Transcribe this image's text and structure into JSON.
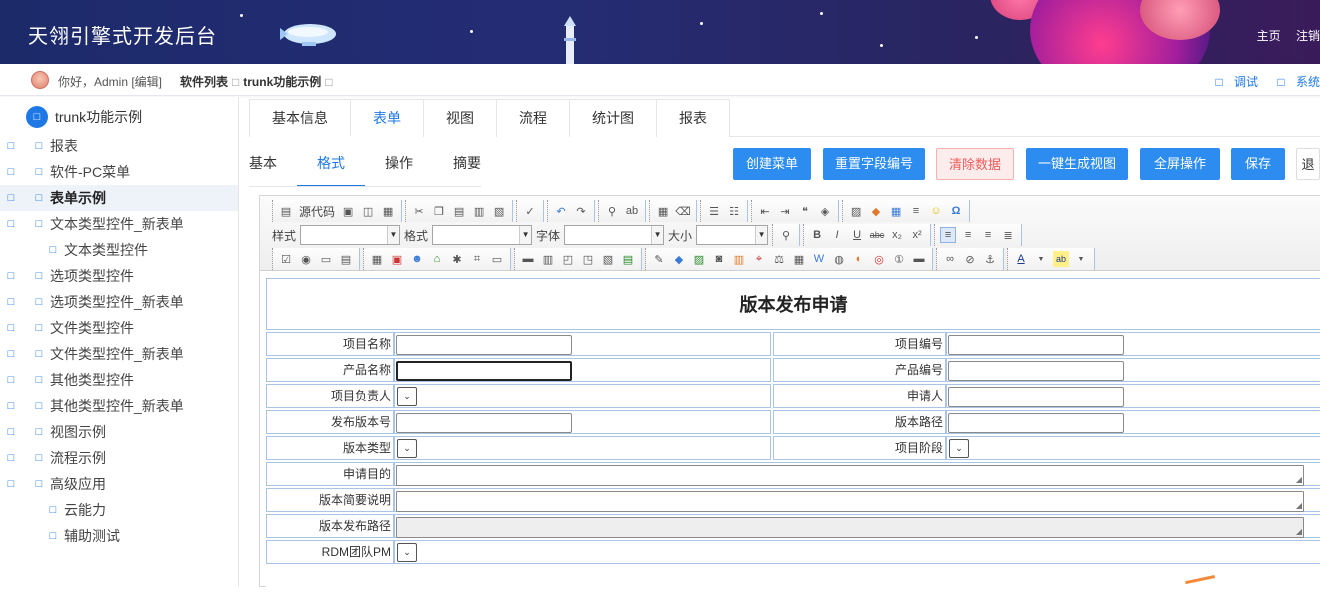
{
  "header": {
    "title": "天翎引擎式开发后台",
    "links": [
      "主页",
      "注销"
    ]
  },
  "subbar": {
    "greeting": "你好，Admin [编辑]",
    "breadcrumb": [
      "软件列表",
      "trunk功能示例"
    ],
    "links": [
      "调试",
      "系统"
    ]
  },
  "sidebar": {
    "root": "trunk功能示例",
    "items": [
      {
        "label": "报表",
        "toggle": true
      },
      {
        "label": "软件-PC菜单",
        "toggle": true
      },
      {
        "label": "表单示例",
        "toggle": true,
        "selected": true
      },
      {
        "label": "文本类型控件_新表单",
        "toggle": true
      },
      {
        "label": "文本类型控件",
        "toggle": false
      },
      {
        "label": "选项类型控件",
        "toggle": true
      },
      {
        "label": "选项类型控件_新表单",
        "toggle": true
      },
      {
        "label": "文件类型控件",
        "toggle": true
      },
      {
        "label": "文件类型控件_新表单",
        "toggle": true
      },
      {
        "label": "其他类型控件",
        "toggle": true
      },
      {
        "label": "其他类型控件_新表单",
        "toggle": true
      },
      {
        "label": "视图示例",
        "toggle": true
      },
      {
        "label": "流程示例",
        "toggle": true
      },
      {
        "label": "高级应用",
        "toggle": true
      },
      {
        "label": "云能力",
        "toggle": false
      },
      {
        "label": "辅助测试",
        "toggle": false
      }
    ]
  },
  "tabs": [
    "基本信息",
    "表单",
    "视图",
    "流程",
    "统计图",
    "报表"
  ],
  "active_tab": "表单",
  "subtabs": [
    "基本",
    "格式",
    "操作",
    "摘要"
  ],
  "active_subtab": "格式",
  "actions": {
    "create_menu": "创建菜单",
    "reset_field": "重置字段编号",
    "clear_data": "清除数据",
    "gen_view": "一键生成视图",
    "fullscreen": "全屏操作",
    "save": "保存",
    "more": "退"
  },
  "toolbar": {
    "source": "源代码",
    "style_label": "样式",
    "format_label": "格式",
    "font_label": "字体",
    "size_label": "大小"
  },
  "form": {
    "title": "版本发布申请",
    "rows": [
      {
        "l1": "项目名称",
        "l2": "项目编号"
      },
      {
        "l1": "产品名称",
        "l2": "产品编号"
      },
      {
        "l1": "项目负责人",
        "l2": "申请人"
      },
      {
        "l1": "发布版本号",
        "l2": "版本路径"
      },
      {
        "l1": "版本类型",
        "l2": "项目阶段"
      }
    ],
    "wide_rows": [
      "申请目的",
      "版本简要说明",
      "版本发布路径",
      "RDM团队PM"
    ]
  },
  "colors": {
    "accent": "#1e78e6",
    "button": "#2d8cf0",
    "danger": "#ef5a5a"
  }
}
